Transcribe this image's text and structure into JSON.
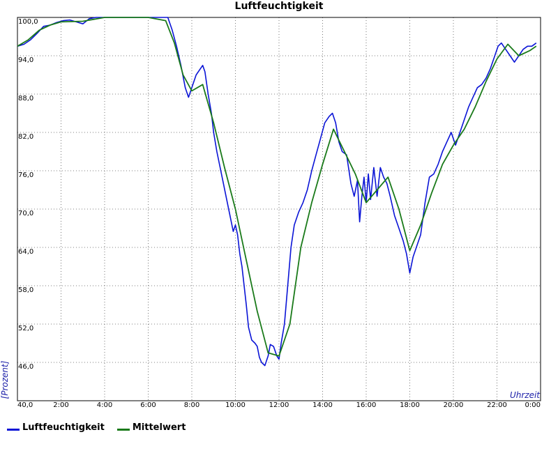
{
  "chart_data": {
    "type": "line",
    "title": "Luftfeuchtigkeit",
    "xlabel": "Uhrzeit",
    "ylabel": "[Prozent]",
    "xlim": [
      0,
      24
    ],
    "ylim": [
      40,
      100
    ],
    "x_ticks": [
      {
        "value": 0,
        "label": "40,0"
      },
      {
        "value": 2,
        "label": "2:00"
      },
      {
        "value": 4,
        "label": "4:00"
      },
      {
        "value": 6,
        "label": "6:00"
      },
      {
        "value": 8,
        "label": "8:00"
      },
      {
        "value": 10,
        "label": "10:00"
      },
      {
        "value": 12,
        "label": "12:00"
      },
      {
        "value": 14,
        "label": "14:00"
      },
      {
        "value": 16,
        "label": "16:00"
      },
      {
        "value": 18,
        "label": "18:00"
      },
      {
        "value": 20,
        "label": "20:00"
      },
      {
        "value": 22,
        "label": "22:00"
      },
      {
        "value": 24,
        "label": "0:00"
      }
    ],
    "y_ticks": [
      {
        "value": 46,
        "label": "46,0"
      },
      {
        "value": 52,
        "label": "52,0"
      },
      {
        "value": 58,
        "label": "58,0"
      },
      {
        "value": 64,
        "label": "64,0"
      },
      {
        "value": 70,
        "label": "70,0"
      },
      {
        "value": 76,
        "label": "76,0"
      },
      {
        "value": 82,
        "label": "82,0"
      },
      {
        "value": 88,
        "label": "88,0"
      },
      {
        "value": 94,
        "label": "94,0"
      },
      {
        "value": 100,
        "label": "100,0"
      }
    ],
    "grid": true,
    "legend_position": "bottom-left",
    "series": [
      {
        "name": "Luftfeuchtigkeit",
        "color": "#0a14d6",
        "x": [
          0,
          0.3,
          0.6,
          0.9,
          1.2,
          1.5,
          1.8,
          2.1,
          2.4,
          2.7,
          3.0,
          3.3,
          3.6,
          4.0,
          5.0,
          6.0,
          6.6,
          6.9,
          7.1,
          7.3,
          7.5,
          7.7,
          7.85,
          8.0,
          8.2,
          8.4,
          8.5,
          8.6,
          8.75,
          8.9,
          9.0,
          9.15,
          9.3,
          9.45,
          9.6,
          9.75,
          9.9,
          10.0,
          10.1,
          10.2,
          10.3,
          10.4,
          10.5,
          10.6,
          10.75,
          10.9,
          11.0,
          11.1,
          11.2,
          11.35,
          11.5,
          11.6,
          11.75,
          11.9,
          12.0,
          12.1,
          12.25,
          12.4,
          12.55,
          12.7,
          12.9,
          13.1,
          13.3,
          13.5,
          13.7,
          13.9,
          14.1,
          14.3,
          14.45,
          14.6,
          14.75,
          14.9,
          15.1,
          15.3,
          15.45,
          15.6,
          15.7,
          15.8,
          15.9,
          16.0,
          16.1,
          16.2,
          16.35,
          16.5,
          16.65,
          16.8,
          16.95,
          17.1,
          17.3,
          17.5,
          17.7,
          17.85,
          18.0,
          18.15,
          18.3,
          18.5,
          18.7,
          18.9,
          19.1,
          19.3,
          19.5,
          19.7,
          19.9,
          20.1,
          20.3,
          20.5,
          20.7,
          20.9,
          21.1,
          21.3,
          21.5,
          21.7,
          21.9,
          22.05,
          22.2,
          22.4,
          22.6,
          22.8,
          23.0,
          23.2,
          23.4,
          23.6,
          23.8
        ],
        "values": [
          95.5,
          95.8,
          96.5,
          97.5,
          98.6,
          98.8,
          99.2,
          99.5,
          99.6,
          99.3,
          99.0,
          99.8,
          100,
          100,
          100,
          100,
          100,
          100,
          98.0,
          95.5,
          92.5,
          89.0,
          87.5,
          89.0,
          91.0,
          92.0,
          92.5,
          91.5,
          88.0,
          85.0,
          82.0,
          79.0,
          76.5,
          74.0,
          71.5,
          69.0,
          66.5,
          67.5,
          66.0,
          63.0,
          61.0,
          58.0,
          55.0,
          51.5,
          49.5,
          49.0,
          48.5,
          46.8,
          46.0,
          45.5,
          47.0,
          48.8,
          48.5,
          47.0,
          46.5,
          49.0,
          52.0,
          58.0,
          64.0,
          67.5,
          69.5,
          71.0,
          73.0,
          76.0,
          78.5,
          81.0,
          83.5,
          84.5,
          85.0,
          83.5,
          80.5,
          79.0,
          78.5,
          74.0,
          72.0,
          74.5,
          68.0,
          72.0,
          75.0,
          71.0,
          75.5,
          71.5,
          76.5,
          72.0,
          76.5,
          75.0,
          74.0,
          72.0,
          69.0,
          67.0,
          65.0,
          63.0,
          60.0,
          62.5,
          64.0,
          66.0,
          71.0,
          75.0,
          75.5,
          77.0,
          79.0,
          80.5,
          82.0,
          80.0,
          82.0,
          84.0,
          86.0,
          87.5,
          89.0,
          89.5,
          90.5,
          92.0,
          94.0,
          95.5,
          96.0,
          95.0,
          94.0,
          93.0,
          94.0,
          95.0,
          95.5,
          95.5,
          96.0
        ]
      },
      {
        "name": "Mittelwert",
        "color": "#1a7a1a",
        "x": [
          0,
          0.5,
          1.0,
          1.5,
          2.0,
          3.0,
          4.0,
          5.0,
          6.0,
          6.8,
          7.2,
          7.6,
          8.0,
          8.5,
          9.0,
          9.5,
          10.0,
          10.5,
          11.0,
          11.5,
          12.0,
          12.5,
          13.0,
          13.5,
          14.0,
          14.5,
          15.0,
          15.5,
          16.0,
          16.5,
          17.0,
          17.5,
          18.0,
          18.5,
          19.0,
          19.5,
          20.0,
          20.5,
          21.0,
          21.5,
          22.0,
          22.5,
          23.0,
          23.5,
          23.8
        ],
        "values": [
          95.5,
          96.5,
          98.0,
          98.8,
          99.3,
          99.4,
          100,
          100,
          100,
          99.5,
          96.0,
          91.0,
          88.5,
          89.5,
          83.5,
          76.5,
          70.0,
          62.0,
          54.0,
          47.5,
          47.0,
          52.0,
          64.0,
          71.0,
          77.0,
          82.5,
          79.0,
          75.5,
          71.0,
          73.0,
          75.0,
          70.0,
          63.5,
          67.5,
          72.5,
          77.0,
          80.0,
          82.5,
          86.0,
          90.0,
          93.5,
          95.8,
          94.0,
          94.8,
          95.5
        ]
      }
    ]
  }
}
